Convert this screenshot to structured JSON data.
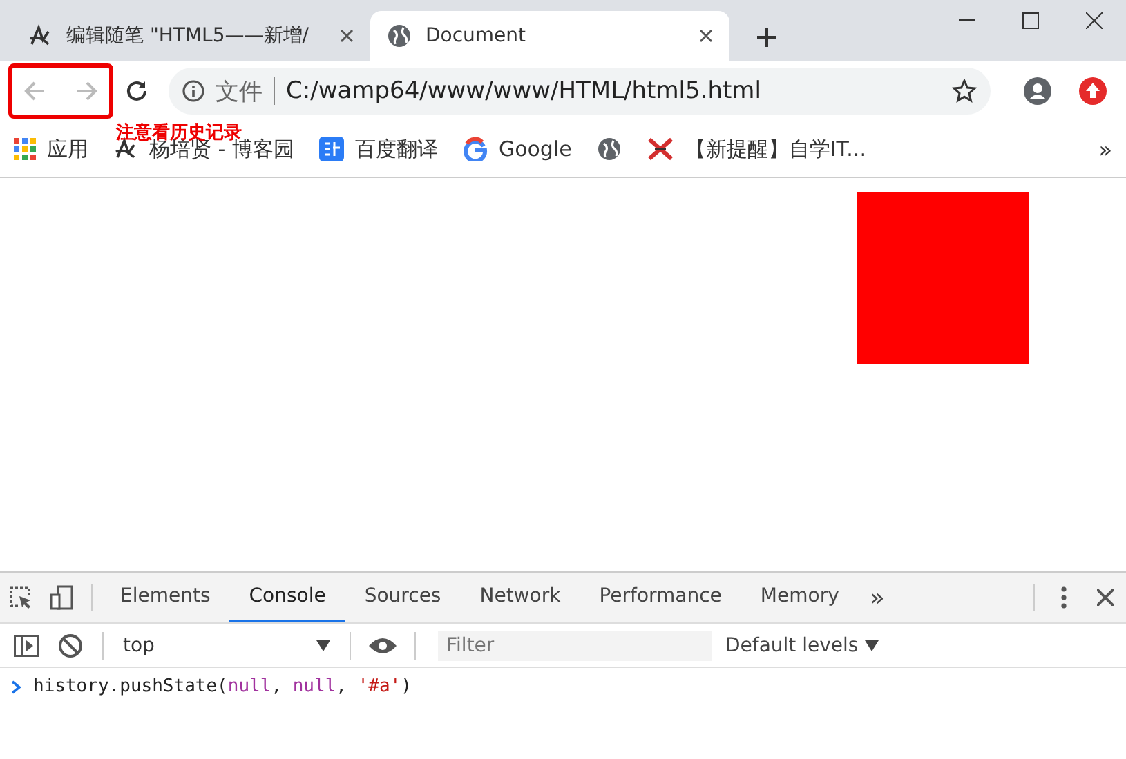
{
  "tabs": [
    {
      "title": "编辑随笔 \"HTML5——新增/",
      "kind": "blog",
      "selected": false
    },
    {
      "title": "Document",
      "kind": "globe",
      "selected": true
    }
  ],
  "toolbar": {
    "back_disabled": true,
    "forward_disabled": true,
    "security_label": "文件",
    "url": "C:/wamp64/www/www/HTML/html5.html"
  },
  "annotation": {
    "note": "注意看历史记录"
  },
  "bookmarks": [
    {
      "label": "应用",
      "kind": "apps"
    },
    {
      "label": "杨培贤 - 博客园",
      "kind": "blog"
    },
    {
      "label": "百度翻译",
      "kind": "translate"
    },
    {
      "label": "Google",
      "kind": "google"
    },
    {
      "kind": "globe"
    },
    {
      "label": "【新提醒】自学IT...",
      "kind": "cross"
    }
  ],
  "bookmarks_more": "»",
  "devtools": {
    "tabs": [
      {
        "label": "Elements",
        "selected": false
      },
      {
        "label": "Console",
        "selected": true
      },
      {
        "label": "Sources",
        "selected": false
      },
      {
        "label": "Network",
        "selected": false
      },
      {
        "label": "Performance",
        "selected": false
      },
      {
        "label": "Memory",
        "selected": false
      }
    ],
    "more": "»",
    "context": "top",
    "filter_placeholder": "Filter",
    "levels": "Default levels",
    "console_line": [
      {
        "kind": "plain",
        "text": "history.pushState("
      },
      {
        "kind": "keyword",
        "text": "null"
      },
      {
        "kind": "plain",
        "text": ", "
      },
      {
        "kind": "keyword",
        "text": "null"
      },
      {
        "kind": "plain",
        "text": ", "
      },
      {
        "kind": "string",
        "text": "'#a'"
      },
      {
        "kind": "plain",
        "text": ")"
      }
    ]
  }
}
